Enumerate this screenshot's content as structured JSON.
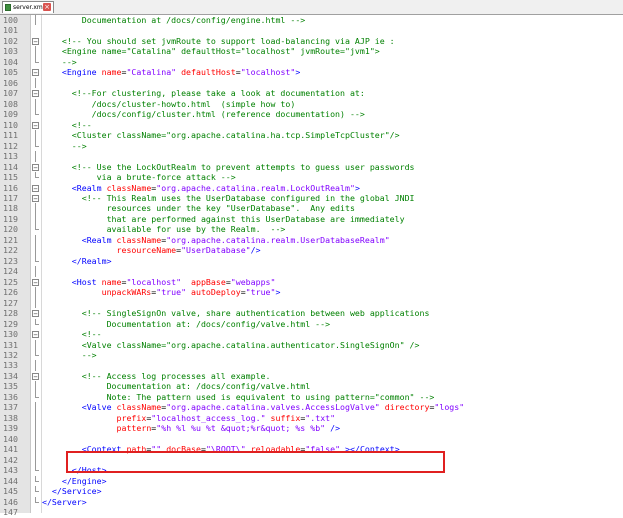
{
  "tab": {
    "label": "server.xml"
  },
  "lines": [
    {
      "n": "100",
      "fold": "bar",
      "segs": [
        {
          "t": "        Documentation at /docs/config/engine.html -->",
          "c": "com"
        }
      ]
    },
    {
      "n": "101",
      "fold": "none",
      "segs": []
    },
    {
      "n": "102",
      "fold": "box",
      "segs": [
        {
          "t": "    <!-- You should set jvmRoute to support load-balancing via AJP ie :",
          "c": "com"
        }
      ]
    },
    {
      "n": "103",
      "fold": "bar",
      "segs": [
        {
          "t": "    <Engine name=\"Catalina\" defaultHost=\"localhost\" jvmRoute=\"jvm1\">",
          "c": "com"
        }
      ]
    },
    {
      "n": "104",
      "fold": "end",
      "segs": [
        {
          "t": "    -->",
          "c": "com"
        }
      ]
    },
    {
      "n": "105",
      "fold": "box",
      "segs": [
        {
          "t": "    <Engine ",
          "c": "tag"
        },
        {
          "t": "name",
          "c": "attr"
        },
        {
          "t": "=",
          "c": "txt"
        },
        {
          "t": "\"Catalina\"",
          "c": "val"
        },
        {
          "t": " ",
          "c": "txt"
        },
        {
          "t": "defaultHost",
          "c": "attr"
        },
        {
          "t": "=",
          "c": "txt"
        },
        {
          "t": "\"localhost\"",
          "c": "val"
        },
        {
          "t": ">",
          "c": "tag"
        }
      ]
    },
    {
      "n": "106",
      "fold": "bar",
      "segs": []
    },
    {
      "n": "107",
      "fold": "box",
      "segs": [
        {
          "t": "      <!--For clustering, please take a look at documentation at:",
          "c": "com"
        }
      ]
    },
    {
      "n": "108",
      "fold": "bar",
      "segs": [
        {
          "t": "          /docs/cluster-howto.html  (simple how to)",
          "c": "com"
        }
      ]
    },
    {
      "n": "109",
      "fold": "end",
      "segs": [
        {
          "t": "          /docs/config/cluster.html (reference documentation) -->",
          "c": "com"
        }
      ]
    },
    {
      "n": "110",
      "fold": "box",
      "segs": [
        {
          "t": "      <!--",
          "c": "com"
        }
      ]
    },
    {
      "n": "111",
      "fold": "bar",
      "segs": [
        {
          "t": "      <Cluster className=\"org.apache.catalina.ha.tcp.SimpleTcpCluster\"/>",
          "c": "com"
        }
      ]
    },
    {
      "n": "112",
      "fold": "end",
      "segs": [
        {
          "t": "      -->",
          "c": "com"
        }
      ]
    },
    {
      "n": "113",
      "fold": "bar",
      "segs": []
    },
    {
      "n": "114",
      "fold": "box",
      "segs": [
        {
          "t": "      <!-- Use the LockOutRealm to prevent attempts to guess user passwords",
          "c": "com"
        }
      ]
    },
    {
      "n": "115",
      "fold": "end",
      "segs": [
        {
          "t": "           via a brute-force attack -->",
          "c": "com"
        }
      ]
    },
    {
      "n": "116",
      "fold": "box",
      "segs": [
        {
          "t": "      <Realm ",
          "c": "tag"
        },
        {
          "t": "className",
          "c": "attr"
        },
        {
          "t": "=",
          "c": "txt"
        },
        {
          "t": "\"org.apache.catalina.realm.LockOutRealm\"",
          "c": "val"
        },
        {
          "t": ">",
          "c": "tag"
        }
      ]
    },
    {
      "n": "117",
      "fold": "box",
      "segs": [
        {
          "t": "        <!-- This Realm uses the UserDatabase configured in the global JNDI",
          "c": "com"
        }
      ]
    },
    {
      "n": "118",
      "fold": "bar",
      "segs": [
        {
          "t": "             resources under the key \"UserDatabase\".  Any edits",
          "c": "com"
        }
      ]
    },
    {
      "n": "119",
      "fold": "bar",
      "segs": [
        {
          "t": "             that are performed against this UserDatabase are immediately",
          "c": "com"
        }
      ]
    },
    {
      "n": "120",
      "fold": "end",
      "segs": [
        {
          "t": "             available for use by the Realm.  -->",
          "c": "com"
        }
      ]
    },
    {
      "n": "121",
      "fold": "bar",
      "segs": [
        {
          "t": "        <Realm ",
          "c": "tag"
        },
        {
          "t": "className",
          "c": "attr"
        },
        {
          "t": "=",
          "c": "txt"
        },
        {
          "t": "\"org.apache.catalina.realm.UserDatabaseRealm\"",
          "c": "val"
        }
      ]
    },
    {
      "n": "122",
      "fold": "bar",
      "segs": [
        {
          "t": "               ",
          "c": "txt"
        },
        {
          "t": "resourceName",
          "c": "attr"
        },
        {
          "t": "=",
          "c": "txt"
        },
        {
          "t": "\"UserDatabase\"",
          "c": "val"
        },
        {
          "t": "/>",
          "c": "tag"
        }
      ]
    },
    {
      "n": "123",
      "fold": "end",
      "segs": [
        {
          "t": "      </Realm>",
          "c": "tag"
        }
      ]
    },
    {
      "n": "124",
      "fold": "bar",
      "segs": []
    },
    {
      "n": "125",
      "fold": "box",
      "segs": [
        {
          "t": "      <Host ",
          "c": "tag"
        },
        {
          "t": "name",
          "c": "attr"
        },
        {
          "t": "=",
          "c": "txt"
        },
        {
          "t": "\"localhost\"",
          "c": "val"
        },
        {
          "t": "  ",
          "c": "txt"
        },
        {
          "t": "appBase",
          "c": "attr"
        },
        {
          "t": "=",
          "c": "txt"
        },
        {
          "t": "\"webapps\"",
          "c": "val"
        }
      ]
    },
    {
      "n": "126",
      "fold": "bar",
      "segs": [
        {
          "t": "            ",
          "c": "txt"
        },
        {
          "t": "unpackWARs",
          "c": "attr"
        },
        {
          "t": "=",
          "c": "txt"
        },
        {
          "t": "\"true\"",
          "c": "val"
        },
        {
          "t": " ",
          "c": "txt"
        },
        {
          "t": "autoDeploy",
          "c": "attr"
        },
        {
          "t": "=",
          "c": "txt"
        },
        {
          "t": "\"true\"",
          "c": "val"
        },
        {
          "t": ">",
          "c": "tag"
        }
      ]
    },
    {
      "n": "127",
      "fold": "bar",
      "segs": []
    },
    {
      "n": "128",
      "fold": "box",
      "segs": [
        {
          "t": "        <!-- SingleSignOn valve, share authentication between web applications",
          "c": "com"
        }
      ]
    },
    {
      "n": "129",
      "fold": "end",
      "segs": [
        {
          "t": "             Documentation at: /docs/config/valve.html -->",
          "c": "com"
        }
      ]
    },
    {
      "n": "130",
      "fold": "box",
      "segs": [
        {
          "t": "        <!--",
          "c": "com"
        }
      ]
    },
    {
      "n": "131",
      "fold": "bar",
      "segs": [
        {
          "t": "        <Valve className=\"org.apache.catalina.authenticator.SingleSignOn\" />",
          "c": "com"
        }
      ]
    },
    {
      "n": "132",
      "fold": "end",
      "segs": [
        {
          "t": "        -->",
          "c": "com"
        }
      ]
    },
    {
      "n": "133",
      "fold": "bar",
      "segs": []
    },
    {
      "n": "134",
      "fold": "box",
      "segs": [
        {
          "t": "        <!-- Access log processes all example.",
          "c": "com"
        }
      ]
    },
    {
      "n": "135",
      "fold": "bar",
      "segs": [
        {
          "t": "             Documentation at: /docs/config/valve.html",
          "c": "com"
        }
      ]
    },
    {
      "n": "136",
      "fold": "end",
      "segs": [
        {
          "t": "             Note: The pattern used is equivalent to using pattern=\"common\" -->",
          "c": "com"
        }
      ]
    },
    {
      "n": "137",
      "fold": "bar",
      "segs": [
        {
          "t": "        <Valve ",
          "c": "tag"
        },
        {
          "t": "className",
          "c": "attr"
        },
        {
          "t": "=",
          "c": "txt"
        },
        {
          "t": "\"org.apache.catalina.valves.AccessLogValve\"",
          "c": "val"
        },
        {
          "t": " ",
          "c": "txt"
        },
        {
          "t": "directory",
          "c": "attr"
        },
        {
          "t": "=",
          "c": "txt"
        },
        {
          "t": "\"logs\"",
          "c": "val"
        }
      ]
    },
    {
      "n": "138",
      "fold": "bar",
      "segs": [
        {
          "t": "               ",
          "c": "txt"
        },
        {
          "t": "prefix",
          "c": "attr"
        },
        {
          "t": "=",
          "c": "txt"
        },
        {
          "t": "\"localhost_access_log.\"",
          "c": "val"
        },
        {
          "t": " ",
          "c": "txt"
        },
        {
          "t": "suffix",
          "c": "attr"
        },
        {
          "t": "=",
          "c": "txt"
        },
        {
          "t": "\".txt\"",
          "c": "val"
        }
      ]
    },
    {
      "n": "139",
      "fold": "bar",
      "segs": [
        {
          "t": "               ",
          "c": "txt"
        },
        {
          "t": "pattern",
          "c": "attr"
        },
        {
          "t": "=",
          "c": "txt"
        },
        {
          "t": "\"%h %l %u %t &quot;%r&quot; %s %b\"",
          "c": "val"
        },
        {
          "t": " />",
          "c": "tag"
        }
      ]
    },
    {
      "n": "140",
      "fold": "bar",
      "segs": []
    },
    {
      "n": "141",
      "fold": "bar",
      "segs": [
        {
          "t": "        <Context ",
          "c": "tag"
        },
        {
          "t": "path",
          "c": "attr"
        },
        {
          "t": "=",
          "c": "txt"
        },
        {
          "t": "\"\"",
          "c": "val"
        },
        {
          "t": " ",
          "c": "txt"
        },
        {
          "t": "docBase",
          "c": "attr"
        },
        {
          "t": "=",
          "c": "txt"
        },
        {
          "t": "\"\\ROOT\\\"",
          "c": "val"
        },
        {
          "t": " ",
          "c": "txt"
        },
        {
          "t": "reloadable",
          "c": "attr"
        },
        {
          "t": "=",
          "c": "txt"
        },
        {
          "t": "\"false\"",
          "c": "val"
        },
        {
          "t": " ></Context>",
          "c": "tag"
        }
      ]
    },
    {
      "n": "142",
      "fold": "bar",
      "segs": []
    },
    {
      "n": "143",
      "fold": "end",
      "segs": [
        {
          "t": "      </Host>",
          "c": "tag"
        }
      ]
    },
    {
      "n": "144",
      "fold": "end",
      "segs": [
        {
          "t": "    </Engine>",
          "c": "tag"
        }
      ]
    },
    {
      "n": "145",
      "fold": "end",
      "segs": [
        {
          "t": "  </Service>",
          "c": "tag"
        }
      ]
    },
    {
      "n": "146",
      "fold": "end",
      "segs": [
        {
          "t": "</Server>",
          "c": "tag"
        }
      ]
    },
    {
      "n": "147",
      "fold": "none",
      "segs": []
    }
  ]
}
